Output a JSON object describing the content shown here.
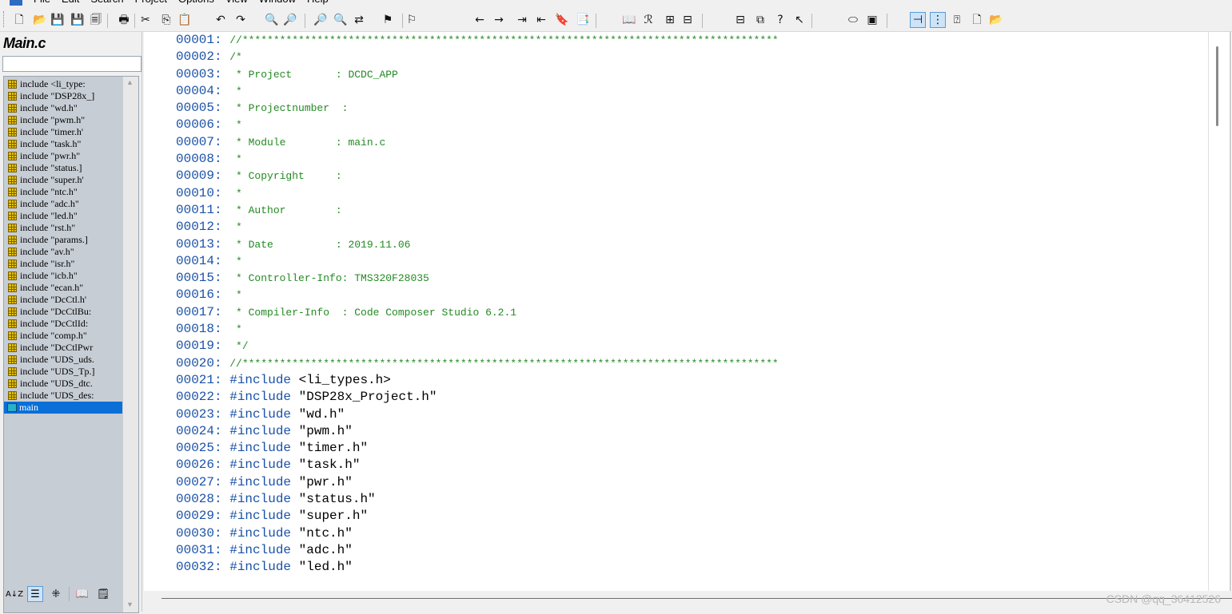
{
  "menu": {
    "items": [
      "File",
      "Edit",
      "Search",
      "Project",
      "Options",
      "View",
      "Window",
      "Help"
    ]
  },
  "toolbar": {
    "buttons": [
      {
        "name": "new-file-icon",
        "glyph": "🗋"
      },
      {
        "name": "open-file-icon",
        "glyph": "📂"
      },
      {
        "name": "save-icon",
        "glyph": "💾"
      },
      {
        "name": "save-as-icon",
        "glyph": "💾"
      },
      {
        "name": "save-all-icon",
        "glyph": "🗐"
      },
      {
        "name": "print-icon",
        "glyph": "🖶"
      },
      {
        "name": "cut-icon",
        "glyph": "✂"
      },
      {
        "name": "copy-icon",
        "glyph": "⎘"
      },
      {
        "name": "paste-icon",
        "glyph": "📋"
      },
      {
        "name": "undo-icon",
        "glyph": "↶"
      },
      {
        "name": "redo-icon",
        "glyph": "↷"
      },
      {
        "name": "find-icon",
        "glyph": "🔍"
      },
      {
        "name": "find-next-icon",
        "glyph": "🔎"
      },
      {
        "name": "find-previous-icon",
        "glyph": "🔎"
      },
      {
        "name": "find-in-files-icon",
        "glyph": "🔍"
      },
      {
        "name": "replace-icon",
        "glyph": "⇄"
      },
      {
        "name": "bookmark-icon",
        "glyph": "⚑"
      },
      {
        "name": "bookmark-next-icon",
        "glyph": "⚐"
      },
      {
        "name": "back-icon",
        "glyph": "←"
      },
      {
        "name": "forward-icon",
        "glyph": "→"
      },
      {
        "name": "indent-icon",
        "glyph": "⇥"
      },
      {
        "name": "outdent-icon",
        "glyph": "⇤"
      },
      {
        "name": "lookup-symbol-icon",
        "glyph": "🔖"
      },
      {
        "name": "symbol-window-icon",
        "glyph": "📑"
      },
      {
        "name": "browse-icon",
        "glyph": "📖"
      },
      {
        "name": "relation-icon",
        "glyph": "ℛ"
      },
      {
        "name": "window-layout-icon",
        "glyph": "⊞"
      },
      {
        "name": "horizontal-split-icon",
        "glyph": "⊟"
      },
      {
        "name": "vertical-split-icon",
        "glyph": "⊟"
      },
      {
        "name": "cascade-icon",
        "glyph": "⧉"
      },
      {
        "name": "context-help-icon",
        "glyph": "?"
      },
      {
        "name": "pointer-help-icon",
        "glyph": "↖"
      },
      {
        "name": "symbol-toggle-icon",
        "glyph": "⬭"
      },
      {
        "name": "layout-toggle-icon",
        "glyph": "▣"
      },
      {
        "name": "tree-icon",
        "glyph": "⊣"
      },
      {
        "name": "graph-icon",
        "glyph": "⋮"
      },
      {
        "name": "info-icon",
        "glyph": "⍰"
      }
    ]
  },
  "symbol_panel": {
    "title": "Main.c",
    "items": [
      {
        "kind": "include",
        "label": "include <li_type:"
      },
      {
        "kind": "include",
        "label": "include \"DSP28x_]"
      },
      {
        "kind": "include",
        "label": "include \"wd.h\""
      },
      {
        "kind": "include",
        "label": "include \"pwm.h\""
      },
      {
        "kind": "include",
        "label": "include \"timer.h'"
      },
      {
        "kind": "include",
        "label": "include \"task.h\""
      },
      {
        "kind": "include",
        "label": "include \"pwr.h\""
      },
      {
        "kind": "include",
        "label": "include \"status.]"
      },
      {
        "kind": "include",
        "label": "include \"super.h'"
      },
      {
        "kind": "include",
        "label": "include \"ntc.h\""
      },
      {
        "kind": "include",
        "label": "include \"adc.h\""
      },
      {
        "kind": "include",
        "label": "include \"led.h\""
      },
      {
        "kind": "include",
        "label": "include \"rst.h\""
      },
      {
        "kind": "include",
        "label": "include \"params.]"
      },
      {
        "kind": "include",
        "label": "include \"av.h\""
      },
      {
        "kind": "include",
        "label": "include \"isr.h\""
      },
      {
        "kind": "include",
        "label": "include \"icb.h\""
      },
      {
        "kind": "include",
        "label": "include \"ecan.h\""
      },
      {
        "kind": "include",
        "label": "include \"DcCtl.h'"
      },
      {
        "kind": "include",
        "label": "include \"DcCtlBu:"
      },
      {
        "kind": "include",
        "label": "include \"DcCtlId:"
      },
      {
        "kind": "include",
        "label": "include \"comp.h\""
      },
      {
        "kind": "include",
        "label": "include \"DcCtlPwr"
      },
      {
        "kind": "include",
        "label": "include \"UDS_uds."
      },
      {
        "kind": "include",
        "label": "include \"UDS_Tp.]"
      },
      {
        "kind": "include",
        "label": "include \"UDS_dtc."
      },
      {
        "kind": "include",
        "label": "include \"UDS_des:"
      },
      {
        "kind": "function",
        "label": "main",
        "selected": true
      }
    ],
    "bottom_tabs": [
      {
        "name": "sort-alpha-icon",
        "glyph": "A↓Z"
      },
      {
        "name": "symbol-list-icon",
        "glyph": "☰",
        "pressed": true
      },
      {
        "name": "category-icon",
        "glyph": "⁜"
      },
      {
        "name": "book-icon",
        "glyph": "📖"
      },
      {
        "name": "properties-icon",
        "glyph": "🗒"
      }
    ]
  },
  "editor": {
    "lines": [
      {
        "n": "00001:",
        "type": "comment",
        "text": "//**************************************************************************************"
      },
      {
        "n": "00002:",
        "type": "comment",
        "text": "/*"
      },
      {
        "n": "00003:",
        "type": "comment",
        "text": " * Project       : DCDC_APP"
      },
      {
        "n": "00004:",
        "type": "comment",
        "text": " *"
      },
      {
        "n": "00005:",
        "type": "comment",
        "text": " * Projectnumber  :"
      },
      {
        "n": "00006:",
        "type": "comment",
        "text": " *"
      },
      {
        "n": "00007:",
        "type": "comment",
        "text": " * Module        : main.c"
      },
      {
        "n": "00008:",
        "type": "comment",
        "text": " *"
      },
      {
        "n": "00009:",
        "type": "comment",
        "text": " * Copyright     :"
      },
      {
        "n": "00010:",
        "type": "comment",
        "text": " *"
      },
      {
        "n": "00011:",
        "type": "comment",
        "text": " * Author        :"
      },
      {
        "n": "00012:",
        "type": "comment",
        "text": " *"
      },
      {
        "n": "00013:",
        "type": "comment",
        "text": " * Date          : 2019.11.06"
      },
      {
        "n": "00014:",
        "type": "comment",
        "text": " *"
      },
      {
        "n": "00015:",
        "type": "comment",
        "text": " * Controller-Info: TMS320F28035"
      },
      {
        "n": "00016:",
        "type": "comment",
        "text": " *"
      },
      {
        "n": "00017:",
        "type": "comment",
        "text": " * Compiler-Info  : Code Composer Studio 6.2.1"
      },
      {
        "n": "00018:",
        "type": "comment",
        "text": " *"
      },
      {
        "n": "00019:",
        "type": "comment",
        "text": " */"
      },
      {
        "n": "00020:",
        "type": "comment",
        "text": "//**************************************************************************************"
      },
      {
        "n": "00021:",
        "type": "include",
        "kw": "#include",
        "arg": "<li_types.h>"
      },
      {
        "n": "00022:",
        "type": "include",
        "kw": "#include",
        "arg": "\"DSP28x_Project.h\""
      },
      {
        "n": "00023:",
        "type": "include",
        "kw": "#include",
        "arg": "\"wd.h\""
      },
      {
        "n": "00024:",
        "type": "include",
        "kw": "#include",
        "arg": "\"pwm.h\""
      },
      {
        "n": "00025:",
        "type": "include",
        "kw": "#include",
        "arg": "\"timer.h\""
      },
      {
        "n": "00026:",
        "type": "include",
        "kw": "#include",
        "arg": "\"task.h\""
      },
      {
        "n": "00027:",
        "type": "include",
        "kw": "#include",
        "arg": "\"pwr.h\""
      },
      {
        "n": "00028:",
        "type": "include",
        "kw": "#include",
        "arg": "\"status.h\""
      },
      {
        "n": "00029:",
        "type": "include",
        "kw": "#include",
        "arg": "\"super.h\""
      },
      {
        "n": "00030:",
        "type": "include",
        "kw": "#include",
        "arg": "\"ntc.h\""
      },
      {
        "n": "00031:",
        "type": "include",
        "kw": "#include",
        "arg": "\"adc.h\""
      },
      {
        "n": "00032:",
        "type": "include",
        "kw": "#include",
        "arg": "\"led.h\""
      }
    ]
  },
  "watermark": "CSDN @qq_36412526",
  "colors": {
    "comment": "#238a23",
    "keyword": "#1a52a8",
    "line_number": "#1a52a8",
    "selection": "#0a6fd6",
    "symbol_list_bg": "#c7cdd5"
  }
}
